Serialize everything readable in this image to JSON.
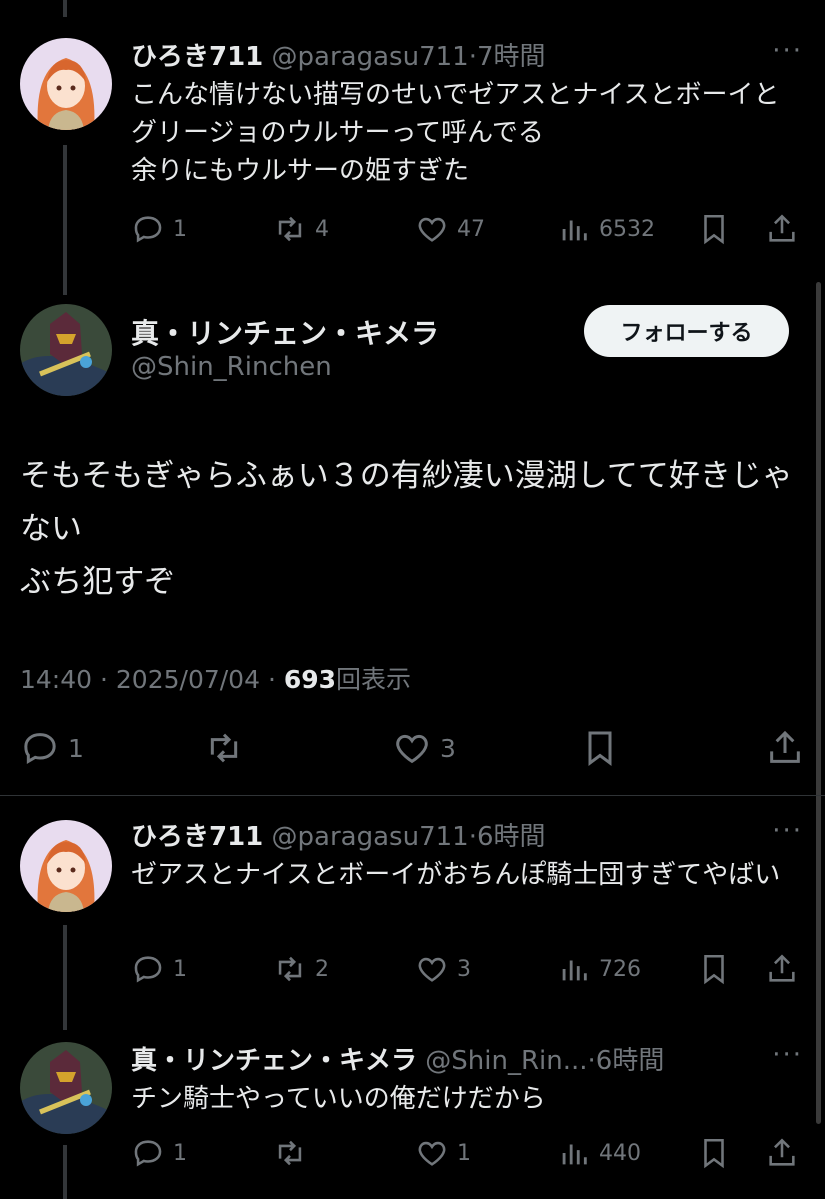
{
  "tweets": [
    {
      "name": "ひろき711",
      "handle": "@paragasu711",
      "time": "7時間",
      "text": "こんな情けない描写のせいでゼアスとナイスとボーイとグリージョのウルサーって呼んでる\n余りにもウルサーの姫すぎた",
      "replies": "1",
      "retweets": "4",
      "likes": "47",
      "views": "6532"
    },
    {
      "name": "ひろき711",
      "handle": "@paragasu711",
      "time": "6時間",
      "text": "ゼアスとナイスとボーイがおちんぽ騎士団すぎてやばい",
      "replies": "1",
      "retweets": "2",
      "likes": "3",
      "views": "726"
    },
    {
      "name": "真・リンチェン・キメラ",
      "handle": "@Shin_Rin...",
      "time": "6時間",
      "text": "チン騎士やっていいの俺だけだから",
      "replies": "1",
      "retweets": "",
      "likes": "1",
      "views": "440"
    }
  ],
  "main": {
    "name": "真・リンチェン・キメラ",
    "handle": "@Shin_Rinchen",
    "follow_label": "フォローする",
    "text": "そもそもぎゃらふぁい３の有紗凄い漫湖してて好きじゃない\nぶち犯すぞ",
    "time": "14:40",
    "date": "2025/07/04",
    "views": "693",
    "views_label": "回表示",
    "replies": "1",
    "likes": "3"
  },
  "separator": "·",
  "more_glyph": "···",
  "icons": [
    "reply-icon",
    "retweet-icon",
    "like-icon",
    "views-icon",
    "bookmark-icon",
    "share-icon",
    "more-icon"
  ],
  "colors": {
    "background": "#000000",
    "text": "#e7e9ea",
    "muted": "#71767b",
    "follow_bg": "#eff3f4"
  }
}
